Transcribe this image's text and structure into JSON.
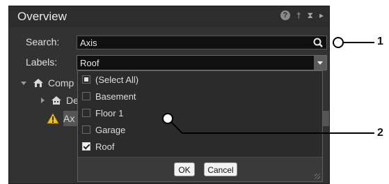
{
  "window": {
    "title": "Overview",
    "help_glyph": "?",
    "pin_glyph": "†",
    "collapse_glyph": "⧗",
    "expand_glyph": "▸"
  },
  "search": {
    "label": "Search:",
    "value": "Axis"
  },
  "labels": {
    "label": "Labels:",
    "value": "Roof"
  },
  "tree": [
    {
      "label": "Comp"
    },
    {
      "label": "De"
    },
    {
      "label": "Ax"
    }
  ],
  "dropdown": {
    "options": [
      {
        "label": "(Select All)",
        "state": "partial"
      },
      {
        "label": "Basement",
        "state": "unchecked"
      },
      {
        "label": "Floor 1",
        "state": "unchecked"
      },
      {
        "label": "Garage",
        "state": "unchecked"
      },
      {
        "label": "Roof",
        "state": "checked"
      }
    ],
    "ok_label": "OK",
    "cancel_label": "Cancel"
  },
  "callouts": [
    "1",
    "2"
  ],
  "colors": {
    "panel_bg": "#323232",
    "field_bg": "#101010",
    "selected_row": "#555555",
    "warning": "#f2c318"
  }
}
